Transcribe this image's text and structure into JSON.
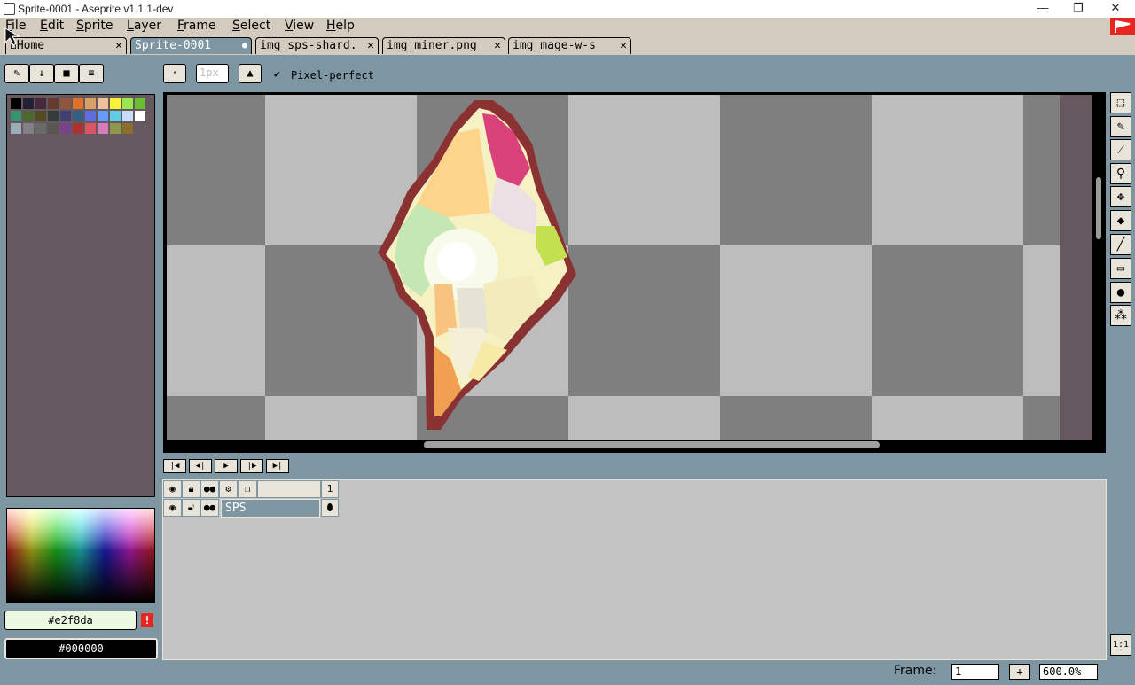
{
  "window": {
    "title": "Sprite-0001 - Aseprite v1.1.1-dev",
    "minimize": "—",
    "maximize": "❐",
    "close": "✕"
  },
  "menu": [
    {
      "first": "F",
      "rest": "ile"
    },
    {
      "first": "E",
      "rest": "dit"
    },
    {
      "first": "S",
      "rest": "prite"
    },
    {
      "first": "L",
      "rest": "ayer"
    },
    {
      "first": "F",
      "rest": "rame"
    },
    {
      "first": "S",
      "rest": "elect"
    },
    {
      "first": "V",
      "rest": "iew"
    },
    {
      "first": "H",
      "rest": "elp"
    }
  ],
  "tabs": [
    {
      "label": "Home",
      "close": "✕"
    },
    {
      "label": "Sprite-0001",
      "close": "●"
    },
    {
      "label": "img_sps-shard.",
      "close": "✕"
    },
    {
      "label": "img_miner.png",
      "close": "✕"
    },
    {
      "label": "img_mage-w-s",
      "close": "✕"
    }
  ],
  "toolbar": {
    "brush_size": "1px",
    "pixel_perfect": "Pixel-perfect",
    "pixel_perfect_checked": true
  },
  "colors": {
    "foreground": "#e2f8da",
    "background": "#000000",
    "warning": "!"
  },
  "palette": [
    "#000000",
    "#222034",
    "#45283c",
    "#663931",
    "#8f563b",
    "#df7126",
    "#d9a066",
    "#eec39a",
    "#fbf236",
    "#99e550",
    "#6abe30",
    "#37946e",
    "#4b692f",
    "#524b24",
    "#323c39",
    "#3f3f74",
    "#306082",
    "#5b6ee1",
    "#639bff",
    "#5fcde4",
    "#cbdbfc",
    "#ffffff",
    "#9badb7",
    "#847e87",
    "#696a6a",
    "#595652",
    "#76428a",
    "#ac3232",
    "#d95763",
    "#d77bba",
    "#8f974a",
    "#8a6f30"
  ],
  "tools": [
    "rect-marquee-icon",
    "eraser-icon",
    "eyedropper-icon",
    "zoom-icon",
    "move-icon",
    "paint-bucket-icon",
    "line-icon",
    "rectangle-icon",
    "contour-icon",
    "spray-icon"
  ],
  "timeline": {
    "frame_header": "1",
    "layer_name": "SPS"
  },
  "status": {
    "frame_label": "Frame:",
    "frame_value": "1",
    "add_frame": "+",
    "zoom": "600.0%",
    "one_to_one": "1:1"
  }
}
